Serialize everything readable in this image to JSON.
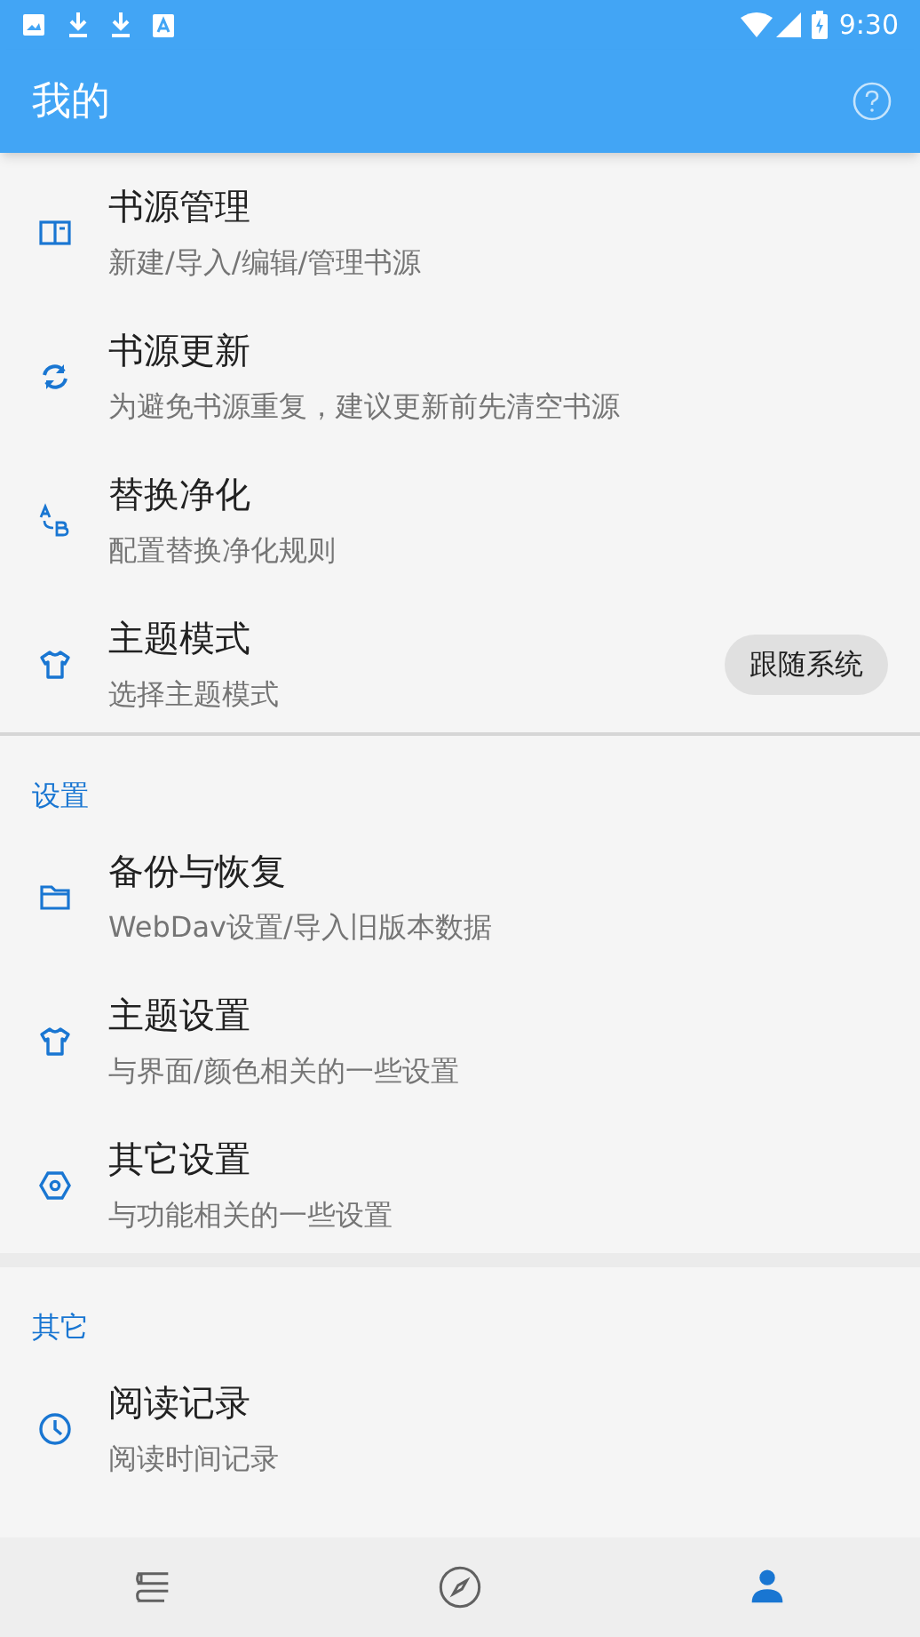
{
  "status_bar": {
    "time": "9:30"
  },
  "app_bar": {
    "title": "我的"
  },
  "sections": [
    {
      "items": [
        {
          "kind": "book",
          "title": "书源管理",
          "subtitle": "新建/导入/编辑/管理书源"
        },
        {
          "kind": "sync",
          "title": "书源更新",
          "subtitle": "为避免书源重复，建议更新前先清空书源"
        },
        {
          "kind": "replace",
          "title": "替换净化",
          "subtitle": "配置替换净化规则"
        },
        {
          "kind": "shirt",
          "title": "主题模式",
          "subtitle": "选择主题模式",
          "value": "跟随系统"
        }
      ]
    },
    {
      "header": "设置",
      "items": [
        {
          "kind": "folder",
          "title": "备份与恢复",
          "subtitle": "WebDav设置/导入旧版本数据"
        },
        {
          "kind": "shirt",
          "title": "主题设置",
          "subtitle": "与界面/颜色相关的一些设置"
        },
        {
          "kind": "hexagon",
          "title": "其它设置",
          "subtitle": "与功能相关的一些设置"
        }
      ]
    },
    {
      "header": "其它",
      "items": [
        {
          "kind": "clock",
          "title": "阅读记录",
          "subtitle": "阅读时间记录"
        }
      ]
    }
  ],
  "bottom_nav": [
    {
      "kind": "books",
      "selected": false
    },
    {
      "kind": "compass",
      "selected": false
    },
    {
      "kind": "person",
      "selected": true
    }
  ]
}
